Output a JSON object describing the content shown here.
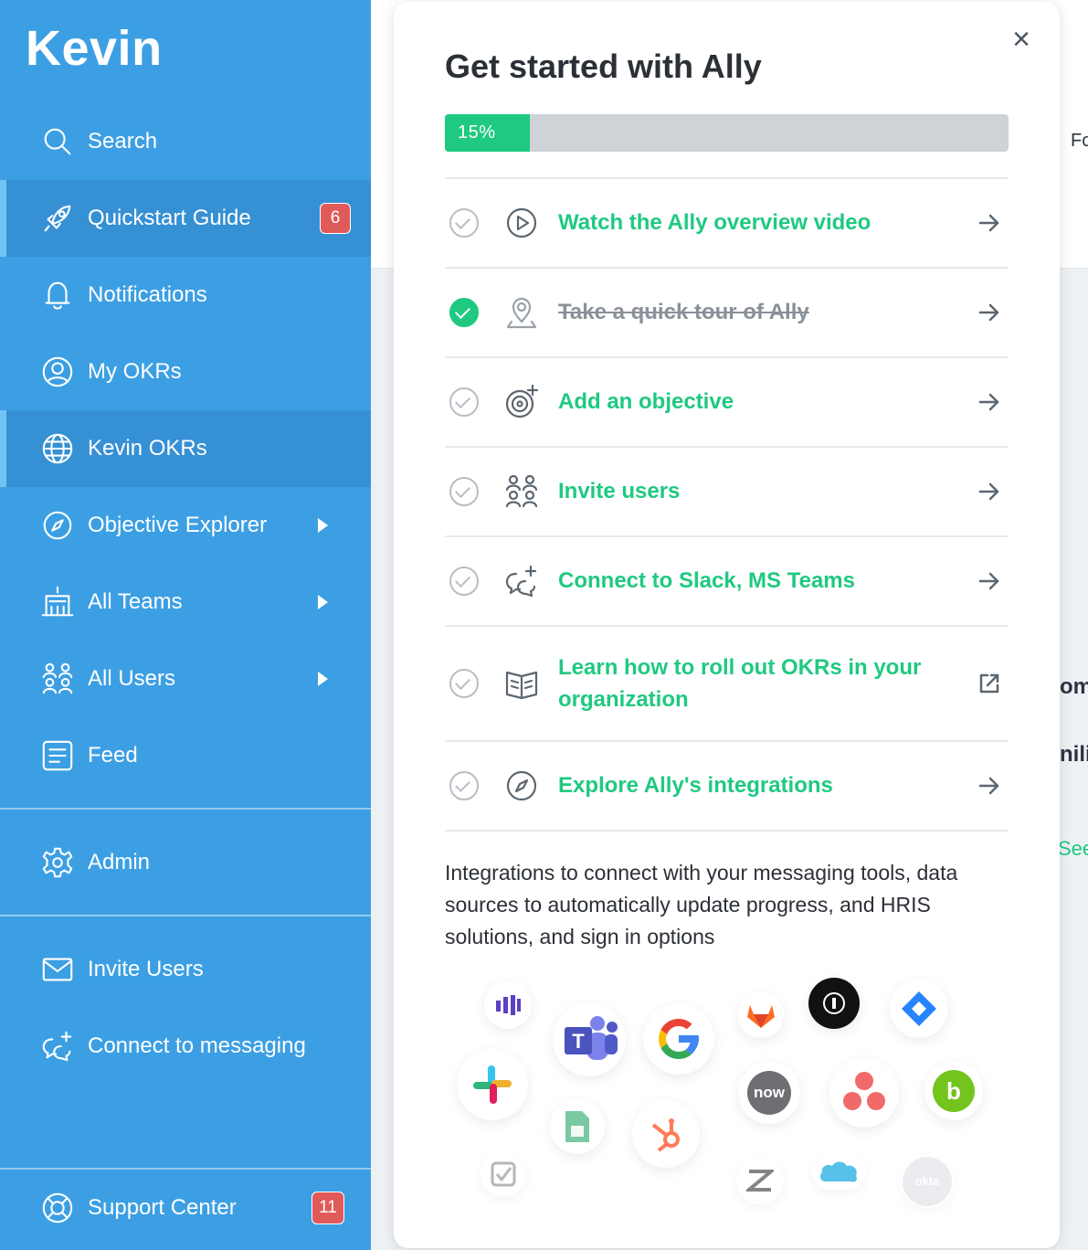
{
  "sidebar": {
    "brand": "Kevin",
    "items": [
      {
        "label": "Search"
      },
      {
        "label": "Quickstart Guide",
        "badge": "6"
      },
      {
        "label": "Notifications"
      },
      {
        "label": "My OKRs"
      },
      {
        "label": "Kevin OKRs"
      },
      {
        "label": "Objective Explorer"
      },
      {
        "label": "All Teams"
      },
      {
        "label": "All Users"
      },
      {
        "label": "Feed"
      },
      {
        "label": "Admin"
      },
      {
        "label": "Invite Users"
      },
      {
        "label": "Connect to messaging"
      },
      {
        "label": "Support Center",
        "badge": "11"
      }
    ]
  },
  "background": {
    "fragments": [
      "Fo",
      "om",
      "nili",
      "See"
    ]
  },
  "panel": {
    "close": "×",
    "title": "Get started with Ally",
    "progress": {
      "percent": 15,
      "label": "15%"
    },
    "tasks": [
      {
        "label": "Watch the Ally overview video",
        "done": false,
        "icon": "play-circle-icon"
      },
      {
        "label": "Take a quick tour of Ally",
        "done": true,
        "icon": "map-pin-icon"
      },
      {
        "label": "Add an objective",
        "done": false,
        "icon": "target-plus-icon"
      },
      {
        "label": "Invite users",
        "done": false,
        "icon": "users-icon"
      },
      {
        "label": "Connect to Slack, MS Teams",
        "done": false,
        "icon": "chat-plus-icon"
      },
      {
        "label": "Learn how to roll out OKRs in your organization",
        "done": false,
        "icon": "book-icon",
        "external": true
      },
      {
        "label": "Explore Ally's integrations",
        "done": false,
        "icon": "compass-icon"
      }
    ],
    "description": "Integrations to connect with your messaging tools, data sources to automatically update progress, and HRIS solutions, and sign in options",
    "logos": [
      "now",
      "okta"
    ]
  },
  "colors": {
    "sidebar": "#3d9fe3",
    "sidebar_active": "#3690d4",
    "accent_green": "#1fc981",
    "badge_red": "#e05a5a"
  }
}
